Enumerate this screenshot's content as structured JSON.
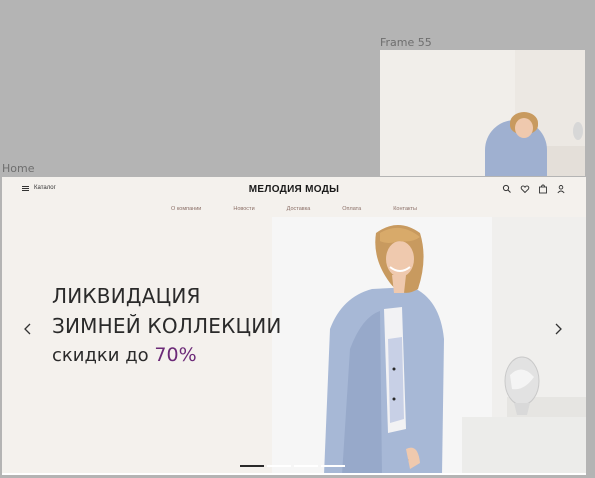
{
  "canvas": {
    "frame55_label": "Frame 55",
    "home_label": "Home"
  },
  "header": {
    "catalog_label": "Каталог",
    "logo": "МЕЛОДИЯ МОДЫ",
    "icons": [
      "search-icon",
      "heart-icon",
      "bag-icon",
      "user-icon"
    ]
  },
  "nav": {
    "items": [
      {
        "label": "О компании"
      },
      {
        "label": "Новости"
      },
      {
        "label": "Доставка"
      },
      {
        "label": "Оплата"
      },
      {
        "label": "Контакты"
      }
    ]
  },
  "hero": {
    "title_line1": "ЛИКВИДАЦИЯ",
    "title_line2": "ЗИМНЕЙ КОЛЛЕКЦИИ",
    "subtitle_prefix": "скидки до ",
    "subtitle_accent": "70%",
    "accent_color": "#6c2a78"
  },
  "slider": {
    "slide_count": 4,
    "active_index": 0
  }
}
